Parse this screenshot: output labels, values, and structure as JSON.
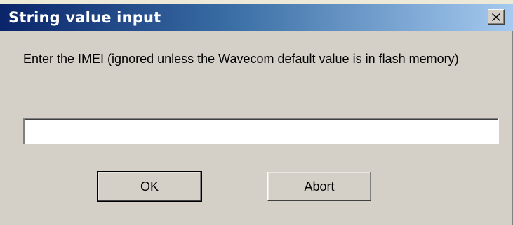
{
  "dialog": {
    "title": "String value input",
    "prompt": "Enter the IMEI (ignored unless the Wavecom default value is in flash memory)",
    "input_value": "",
    "ok_label": "OK",
    "abort_label": "Abort"
  },
  "colors": {
    "titlebar_start": "#0a246a",
    "titlebar_end": "#a6caf0",
    "face": "#d4d0c8"
  },
  "icons": {
    "close": "close-icon"
  }
}
